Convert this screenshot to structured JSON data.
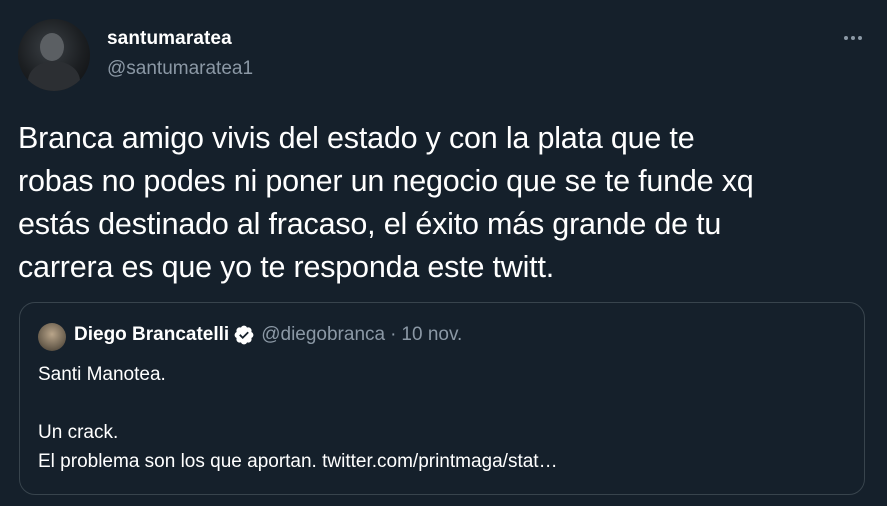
{
  "author": {
    "display_name": "santumaratea",
    "handle": "@santumaratea1"
  },
  "tweet": {
    "text_lines": [
      "Branca amigo vivis del estado y con la plata que te",
      "robas no podes ni poner un negocio que se te funde xq",
      "estás destinado al fracaso, el éxito más grande de tu",
      "carrera es que yo te responda este twitt."
    ]
  },
  "quoted_tweet": {
    "display_name": "Diego Brancatelli",
    "handle": "@diegobranca",
    "separator": "·",
    "date": "10 nov.",
    "lines": [
      "Santi Manotea.",
      "",
      "Un crack.",
      "El problema son los que aportan. twitter.com/printmaga/stat…"
    ]
  },
  "icons": {
    "more": "more-options-icon",
    "verified": "verified-badge-icon"
  },
  "colors": {
    "background": "#15202b",
    "secondary_text": "#8b98a5",
    "border": "#38444d",
    "text": "#ffffff"
  }
}
